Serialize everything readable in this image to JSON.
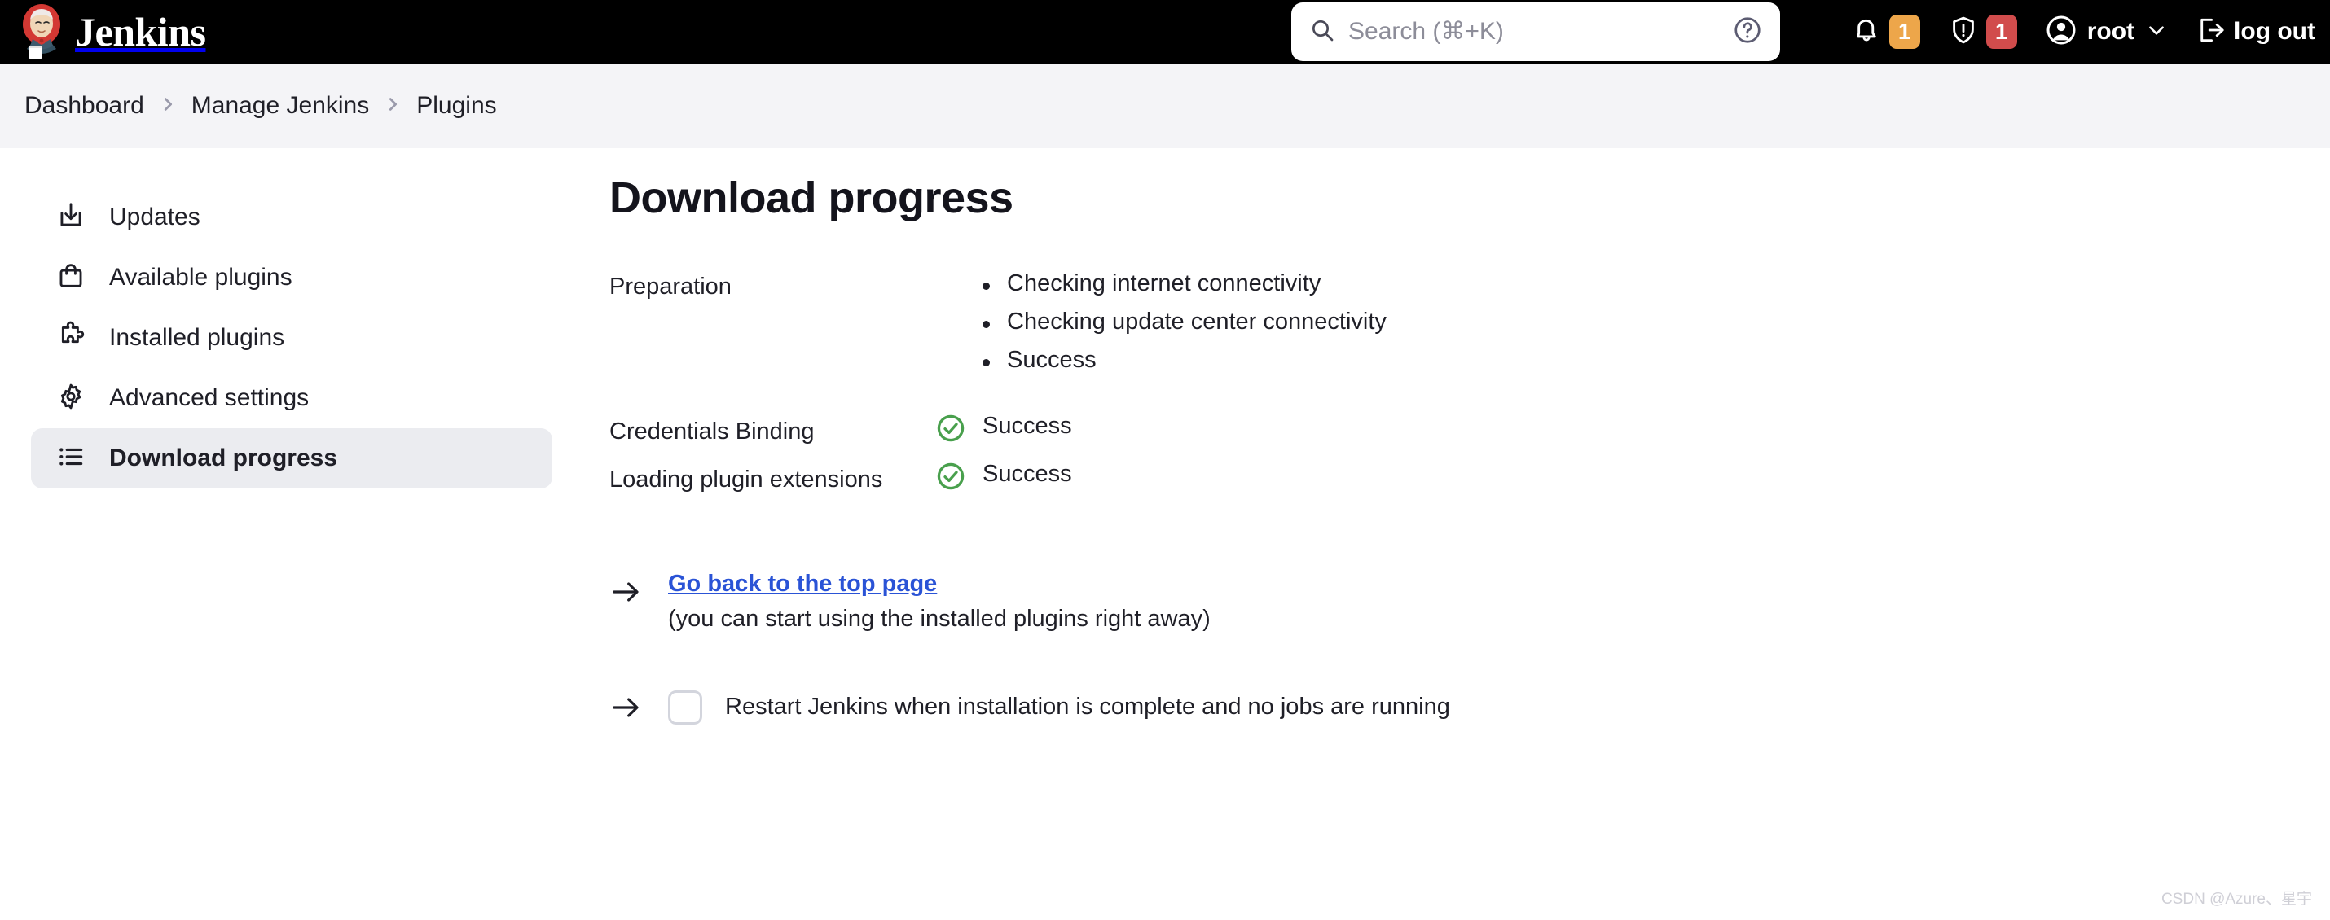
{
  "header": {
    "brand_name": "Jenkins",
    "logo_icon": "jenkins-butler-logo",
    "search": {
      "placeholder": "Search (⌘+K)",
      "value": "",
      "search_icon": "search-icon",
      "help_icon": "question-circle-icon"
    },
    "notifications": {
      "icon": "bell-icon",
      "count": "1",
      "badge_color": "#eda64a"
    },
    "security": {
      "icon": "shield-warning-icon",
      "count": "1",
      "badge_color": "#d14c4c"
    },
    "user": {
      "avatar_icon": "user-circle-icon",
      "name": "root",
      "chevron_icon": "chevron-down-icon"
    },
    "logout": {
      "icon": "logout-icon",
      "label": "log out"
    }
  },
  "breadcrumb": {
    "items": [
      {
        "label": "Dashboard"
      },
      {
        "label": "Manage Jenkins"
      },
      {
        "label": "Plugins"
      }
    ],
    "separator_icon": "chevron-right-icon"
  },
  "sidebar": {
    "items": [
      {
        "label": "Updates",
        "icon": "download-tray-icon",
        "active": false
      },
      {
        "label": "Available plugins",
        "icon": "shopping-bag-icon",
        "active": false
      },
      {
        "label": "Installed plugins",
        "icon": "puzzle-piece-icon",
        "active": false
      },
      {
        "label": "Advanced settings",
        "icon": "gear-icon",
        "active": false
      },
      {
        "label": "Download progress",
        "icon": "list-icon",
        "active": true
      }
    ]
  },
  "main": {
    "title": "Download progress",
    "preparation": {
      "label": "Preparation",
      "steps": [
        "Checking internet connectivity",
        "Checking update center connectivity",
        "Success"
      ]
    },
    "plugin_rows": [
      {
        "name": "Credentials Binding",
        "status": "Success",
        "status_icon": "check-circle-icon",
        "status_color": "#49a04d"
      },
      {
        "name": "Loading plugin extensions",
        "status": "Success",
        "status_icon": "check-circle-icon",
        "status_color": "#49a04d"
      }
    ],
    "back_link": {
      "arrow_icon": "arrow-right-icon",
      "label": "Go back to the top page",
      "sublabel": "(you can start using the installed plugins right away)",
      "color": "#2a53d6"
    },
    "restart": {
      "arrow_icon": "arrow-right-icon",
      "checkbox_checked": false,
      "label": "Restart Jenkins when installation is complete and no jobs are running"
    }
  },
  "watermark": "CSDN @Azure、星宇"
}
